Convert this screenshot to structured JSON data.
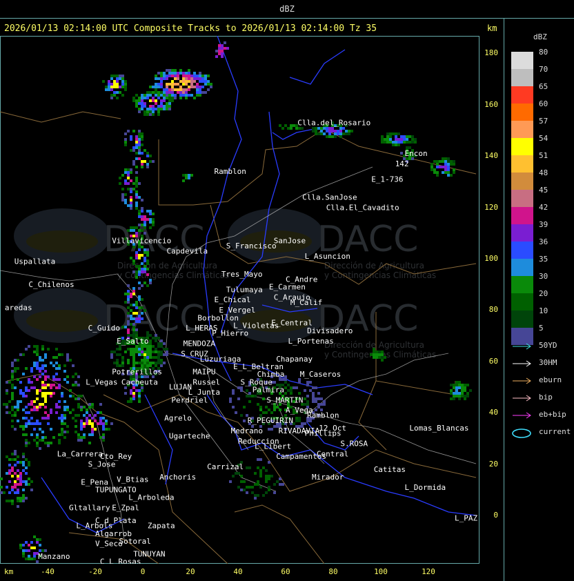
{
  "window_title": "dBZ",
  "header": "2026/01/13 02:14:00 UTC Composite Tracks to 2026/01/13 02:14:00 Tz 35",
  "km_unit": "km",
  "y_ticks": [
    {
      "label": "180",
      "km": 180
    },
    {
      "label": "160",
      "km": 160
    },
    {
      "label": "140",
      "km": 140
    },
    {
      "label": "120",
      "km": 120
    },
    {
      "label": "100",
      "km": 100
    },
    {
      "label": "80",
      "km": 80
    },
    {
      "label": "60",
      "km": 60
    },
    {
      "label": "40",
      "km": 40
    },
    {
      "label": "20",
      "km": 20
    },
    {
      "label": "0",
      "km": 0
    }
  ],
  "x_ticks": [
    {
      "label": "-40",
      "km": -40
    },
    {
      "label": "-20",
      "km": -20
    },
    {
      "label": "0",
      "km": 0
    },
    {
      "label": "20",
      "km": 20
    },
    {
      "label": "40",
      "km": 40
    },
    {
      "label": "60",
      "km": 60
    },
    {
      "label": "80",
      "km": 80
    },
    {
      "label": "100",
      "km": 100
    },
    {
      "label": "120",
      "km": 120
    }
  ],
  "legend": {
    "title": "dBZ",
    "levels": [
      {
        "label": "80",
        "color": "#dcdcdc"
      },
      {
        "label": "70",
        "color": "#bebebe"
      },
      {
        "label": "65",
        "color": "#ff3a22"
      },
      {
        "label": "60",
        "color": "#ff6a00"
      },
      {
        "label": "57",
        "color": "#ff9a55"
      },
      {
        "label": "54",
        "color": "#ffff00"
      },
      {
        "label": "51",
        "color": "#ffc030"
      },
      {
        "label": "48",
        "color": "#d28c3c"
      },
      {
        "label": "45",
        "color": "#c86e82"
      },
      {
        "label": "42",
        "color": "#d0148c"
      },
      {
        "label": "39",
        "color": "#7a1ed2"
      },
      {
        "label": "36",
        "color": "#2a4cff"
      },
      {
        "label": "35",
        "color": "#1e8cdc"
      },
      {
        "label": "30",
        "color": "#0a8a0a"
      },
      {
        "label": "20",
        "color": "#006000"
      },
      {
        "label": "10",
        "color": "#00440a"
      },
      {
        "label": "5",
        "color": "#464696"
      }
    ],
    "tracks": [
      {
        "label": "50YD",
        "color": "#40e0e0",
        "shape": "arrow"
      },
      {
        "label": "30HM",
        "color": "#ffffff",
        "shape": "arrow"
      },
      {
        "label": "eburn",
        "color": "#f0b060",
        "shape": "arrow"
      },
      {
        "label": "bip",
        "color": "#ffc0c8",
        "shape": "arrow"
      },
      {
        "label": "eb+bip",
        "color": "#ff40ff",
        "shape": "arrow"
      },
      {
        "label": "current",
        "color": "#40e0ff",
        "shape": "ellipse"
      }
    ]
  },
  "watermark": {
    "name": "DACC",
    "line1": "Dirección de Agricultura",
    "line2": "y Contingencias Climáticas"
  },
  "places": [
    {
      "name": "Clla.del_Rosario",
      "km": [
        65,
        152
      ]
    },
    {
      "name": "Encon",
      "km": [
        110,
        140
      ]
    },
    {
      "name": "142",
      "km": [
        106,
        136
      ]
    },
    {
      "name": "E_1-736",
      "km": [
        96,
        130
      ]
    },
    {
      "name": "Ramblon",
      "km": [
        30,
        133
      ]
    },
    {
      "name": "Clla.SanJose",
      "km": [
        67,
        123
      ]
    },
    {
      "name": "Clla.El_Cavadito",
      "km": [
        77,
        119
      ]
    },
    {
      "name": "Villavicencio",
      "km": [
        -13,
        106
      ]
    },
    {
      "name": "Capdevila",
      "km": [
        10,
        102
      ]
    },
    {
      "name": "S_Francisco",
      "km": [
        35,
        104
      ]
    },
    {
      "name": "SanJose",
      "km": [
        55,
        106
      ]
    },
    {
      "name": "L_Asuncion",
      "km": [
        68,
        100
      ]
    },
    {
      "name": "Uspallata",
      "km": [
        -54,
        98
      ]
    },
    {
      "name": "Tres_Mayo",
      "km": [
        33,
        93
      ]
    },
    {
      "name": "E_Carmen",
      "km": [
        53,
        88
      ]
    },
    {
      "name": "C_Andre",
      "km": [
        60,
        91
      ]
    },
    {
      "name": "Tulumaya",
      "km": [
        35,
        87
      ]
    },
    {
      "name": "C_Chilenos",
      "km": [
        -48,
        89
      ]
    },
    {
      "name": "E_Chical",
      "km": [
        30,
        83
      ]
    },
    {
      "name": "C_Araujo",
      "km": [
        55,
        84
      ]
    },
    {
      "name": "M_Calif",
      "km": [
        62,
        82
      ]
    },
    {
      "name": "E_Vergel",
      "km": [
        32,
        79
      ]
    },
    {
      "name": "Borbollon",
      "km": [
        23,
        76
      ]
    },
    {
      "name": "L_Violetas",
      "km": [
        38,
        73
      ]
    },
    {
      "name": "E_Central",
      "km": [
        54,
        74
      ]
    },
    {
      "name": "Divisadero",
      "km": [
        69,
        71
      ]
    },
    {
      "name": "L_HERAS",
      "km": [
        18,
        72
      ]
    },
    {
      "name": "P_Hierro",
      "km": [
        29,
        70
      ]
    },
    {
      "name": "C_Guido",
      "km": [
        -23,
        72
      ]
    },
    {
      "name": "MENDOZA",
      "km": [
        17,
        66
      ]
    },
    {
      "name": "E_Salto",
      "km": [
        -11,
        67
      ]
    },
    {
      "name": "L_Portenas",
      "km": [
        61,
        67
      ]
    },
    {
      "name": "S_CRUZ",
      "km": [
        16,
        62
      ]
    },
    {
      "name": "Luzuriaga",
      "km": [
        24,
        60
      ]
    },
    {
      "name": "Chapanay",
      "km": [
        56,
        60
      ]
    },
    {
      "name": "E_L_Beltran",
      "km": [
        38,
        57
      ]
    },
    {
      "name": "Chimba",
      "km": [
        48,
        54
      ]
    },
    {
      "name": "M_Caseros",
      "km": [
        66,
        54
      ]
    },
    {
      "name": "MAIPU",
      "km": [
        21,
        55
      ]
    },
    {
      "name": "Potrerillos",
      "km": [
        -13,
        55
      ]
    },
    {
      "name": "Russel",
      "km": [
        21,
        51
      ]
    },
    {
      "name": "S_Roque",
      "km": [
        41,
        51
      ]
    },
    {
      "name": "L_Vegas",
      "km": [
        -24,
        51
      ]
    },
    {
      "name": "Cacheuta",
      "km": [
        -9,
        51
      ]
    },
    {
      "name": "LUJAN",
      "km": [
        11,
        49
      ]
    },
    {
      "name": "L_Junta",
      "km": [
        19,
        47
      ]
    },
    {
      "name": "Palmira",
      "km": [
        46,
        48
      ]
    },
    {
      "name": "Perdriel",
      "km": [
        12,
        44
      ]
    },
    {
      "name": "S_MARTIN",
      "km": [
        52,
        44
      ]
    },
    {
      "name": "A_Vega",
      "km": [
        60,
        40
      ]
    },
    {
      "name": "Ramblon",
      "km": [
        69,
        38
      ]
    },
    {
      "name": "Agrelo",
      "km": [
        9,
        37
      ]
    },
    {
      "name": "R_PEGUIRIN",
      "km": [
        44,
        36
      ]
    },
    {
      "name": "Lomas_Blancas",
      "km": [
        112,
        33
      ]
    },
    {
      "name": "Medrano",
      "km": [
        37,
        32
      ]
    },
    {
      "name": "RIVADAVIA",
      "km": [
        57,
        32
      ]
    },
    {
      "name": "Phillips",
      "km": [
        68,
        31
      ]
    },
    {
      "name": "12_Oct",
      "km": [
        74,
        33
      ]
    },
    {
      "name": "Ugarteche",
      "km": [
        11,
        30
      ]
    },
    {
      "name": "Reduccion",
      "km": [
        40,
        28
      ]
    },
    {
      "name": "S.ROSA",
      "km": [
        83,
        27
      ]
    },
    {
      "name": "L_Libert",
      "km": [
        47,
        26
      ]
    },
    {
      "name": "La_Carrera",
      "km": [
        -36,
        23
      ]
    },
    {
      "name": "Cto_Rey",
      "km": [
        -18,
        22
      ]
    },
    {
      "name": "Central",
      "km": [
        73,
        23
      ]
    },
    {
      "name": "Campamentos",
      "km": [
        56,
        22
      ]
    },
    {
      "name": "S_Jose",
      "km": [
        -23,
        19
      ]
    },
    {
      "name": "Catitas",
      "km": [
        97,
        17
      ]
    },
    {
      "name": "Carrizal",
      "km": [
        27,
        18
      ]
    },
    {
      "name": "Anchoris",
      "km": [
        7,
        14
      ]
    },
    {
      "name": "V_Btias",
      "km": [
        -11,
        13
      ]
    },
    {
      "name": "Mirador",
      "km": [
        71,
        14
      ]
    },
    {
      "name": "E_Pena",
      "km": [
        -26,
        12
      ]
    },
    {
      "name": "TUPUNGATO",
      "km": [
        -20,
        9
      ]
    },
    {
      "name": "L_Dormida",
      "km": [
        110,
        10
      ]
    },
    {
      "name": "L_Arboleda",
      "km": [
        -6,
        6
      ]
    },
    {
      "name": "Gltallary",
      "km": [
        -31,
        2
      ]
    },
    {
      "name": "E_Zpal",
      "km": [
        -13,
        2
      ]
    },
    {
      "name": "C_d_Plata",
      "km": [
        -20,
        -3
      ]
    },
    {
      "name": "L_Arbols",
      "km": [
        -28,
        -5
      ]
    },
    {
      "name": "Zapata",
      "km": [
        2,
        -5
      ]
    },
    {
      "name": "L_PAZ",
      "km": [
        131,
        -2
      ]
    },
    {
      "name": "Algarrob",
      "km": [
        -20,
        -8
      ]
    },
    {
      "name": "V_Seco",
      "km": [
        -20,
        -12
      ]
    },
    {
      "name": "Sotoral",
      "km": [
        -10,
        -11
      ]
    },
    {
      "name": "TUNUYAN",
      "km": [
        -4,
        -16
      ]
    },
    {
      "name": "Manzano",
      "km": [
        -44,
        -17
      ]
    },
    {
      "name": "C_L_Rosas",
      "km": [
        -18,
        -19
      ]
    },
    {
      "name": "V_Flores",
      "km": [
        -23,
        -25
      ]
    },
    {
      "name": "aredas",
      "km": [
        -58,
        80
      ]
    }
  ]
}
